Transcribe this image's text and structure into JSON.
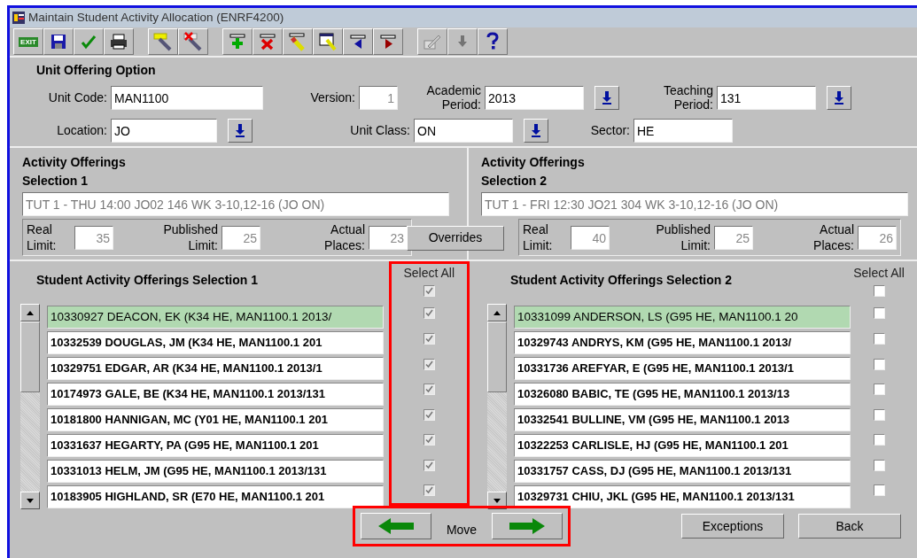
{
  "window": {
    "title": "Maintain Student Activity Allocation (ENRF4200)"
  },
  "toolbar": [
    [
      {
        "kind": "exit",
        "label": "EXIT",
        "disabled": false
      },
      {
        "kind": "save",
        "disabled": false
      },
      {
        "kind": "accept",
        "disabled": false
      },
      {
        "kind": "print",
        "disabled": false
      }
    ],
    [
      {
        "kind": "enter-query",
        "disabled": false
      },
      {
        "kind": "cancel-query",
        "disabled": false
      }
    ],
    [
      {
        "kind": "insert",
        "disabled": false
      },
      {
        "kind": "delete",
        "disabled": false
      },
      {
        "kind": "duplicate",
        "disabled": false
      },
      {
        "kind": "form",
        "disabled": false
      },
      {
        "kind": "previous",
        "disabled": false
      },
      {
        "kind": "next",
        "disabled": false
      }
    ],
    [
      {
        "kind": "edit",
        "disabled": true
      },
      {
        "kind": "lookup",
        "disabled": true
      },
      {
        "kind": "help",
        "disabled": false
      }
    ]
  ],
  "unit_offering": {
    "title": "Unit Offering Option",
    "rows": [
      [
        {
          "label": "Unit Code:",
          "value": "MAN1100",
          "lookup": false,
          "disabled": false
        },
        {
          "label": "Version:",
          "value": "1",
          "lookup": false,
          "disabled": true
        },
        {
          "label": "Academic Period:",
          "value": "2013",
          "lookup": true,
          "disabled": false
        },
        {
          "label": "Teaching Period:",
          "value": "131",
          "lookup": true,
          "disabled": false
        }
      ],
      [
        {
          "label": "Location:",
          "value": "JO",
          "lookup": true,
          "disabled": false
        },
        {
          "label": "Unit Class:",
          "value": "ON",
          "lookup": true,
          "disabled": false
        },
        {
          "label": "Sector:",
          "value": "HE",
          "lookup": false,
          "disabled": false
        }
      ]
    ]
  },
  "activity_offerings": [
    {
      "title": "Activity Offerings",
      "subtitle": "Selection 1",
      "description": "TUT 1 - THU 14:00 JO02 146 WK 3-10,12-16 (JO ON)",
      "limits": [
        {
          "label": "Real Limit:",
          "value": "35"
        },
        {
          "label": "Published Limit:",
          "value": "25"
        },
        {
          "label": "Actual Places:",
          "value": "23"
        }
      ]
    },
    {
      "title": "Activity Offerings",
      "subtitle": "Selection 2",
      "description": "TUT 1 - FRI 12:30 JO21 304 WK 3-10,12-16 (JO ON)",
      "limits": [
        {
          "label": "Real Limit:",
          "value": "40"
        },
        {
          "label": "Published Limit:",
          "value": "25"
        },
        {
          "label": "Actual Places:",
          "value": "26"
        }
      ]
    }
  ],
  "overrides_button": "Overrides",
  "student_lists": [
    {
      "title": "Student Activity Offerings Selection 1",
      "select_all_label": "Select All",
      "select_all_checked": true,
      "checkboxes_disabled": true,
      "highlighted": true,
      "rows": [
        {
          "text": "10330927 DEACON, EK (K34 HE, MAN1100.1 2013/",
          "selected": true,
          "checked": true
        },
        {
          "text": "10332539 DOUGLAS, JM (K34 HE, MAN1100.1 201",
          "selected": false,
          "checked": true
        },
        {
          "text": "10329751 EDGAR, AR (K34 HE, MAN1100.1 2013/1",
          "selected": false,
          "checked": true
        },
        {
          "text": "10174973 GALE, BE (K34 HE, MAN1100.1 2013/131",
          "selected": false,
          "checked": true
        },
        {
          "text": "10181800 HANNIGAN, MC (Y01 HE, MAN1100.1 201",
          "selected": false,
          "checked": true
        },
        {
          "text": "10331637 HEGARTY, PA (G95 HE, MAN1100.1 201",
          "selected": false,
          "checked": true
        },
        {
          "text": "10331013 HELM, JM (G95 HE, MAN1100.1 2013/131",
          "selected": false,
          "checked": true
        },
        {
          "text": "10183905 HIGHLAND, SR (E70 HE, MAN1100.1 201",
          "selected": false,
          "checked": true
        }
      ]
    },
    {
      "title": "Student Activity Offerings Selection 2",
      "select_all_label": "Select All",
      "select_all_checked": false,
      "checkboxes_disabled": false,
      "highlighted": false,
      "rows": [
        {
          "text": "10331099 ANDERSON, LS (G95 HE, MAN1100.1 20",
          "selected": true,
          "checked": false
        },
        {
          "text": "10329743 ANDRYS, KM (G95 HE, MAN1100.1 2013/",
          "selected": false,
          "checked": false
        },
        {
          "text": "10331736 AREFYAR, E (G95 HE, MAN1100.1 2013/1",
          "selected": false,
          "checked": false
        },
        {
          "text": "10326080 BABIC, TE (G95 HE, MAN1100.1 2013/13",
          "selected": false,
          "checked": false
        },
        {
          "text": "10332541 BULLINE, VM (G95 HE, MAN1100.1 2013",
          "selected": false,
          "checked": false
        },
        {
          "text": "10322253 CARLISLE, HJ (G95 HE, MAN1100.1 201",
          "selected": false,
          "checked": false
        },
        {
          "text": "10331757 CASS, DJ (G95 HE, MAN1100.1 2013/131",
          "selected": false,
          "checked": false
        },
        {
          "text": "10329731 CHIU, JKL (G95 HE, MAN1100.1 2013/131",
          "selected": false,
          "checked": false
        }
      ]
    }
  ],
  "move": {
    "label": "Move",
    "highlighted": true
  },
  "buttons": [
    "Exceptions",
    "Back"
  ]
}
